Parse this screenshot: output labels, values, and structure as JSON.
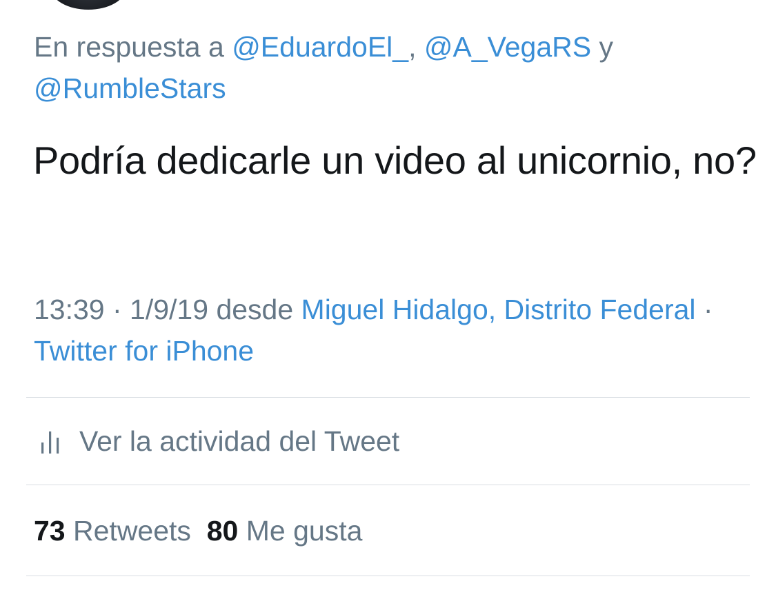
{
  "reply_context": {
    "prefix": "En respuesta a ",
    "mention_1": "@EduardoEl_",
    "separator": ", ",
    "mention_2": "@A_VegaRS",
    "conjunction": " y ",
    "mention_3": "@RumbleStars"
  },
  "tweet": {
    "text": "Podría dedicarle un video al unicornio, no?"
  },
  "meta": {
    "time": "13:39",
    "dot_1": " · ",
    "date": "1/9/19",
    "from_label": " desde ",
    "location": "Miguel Hidalgo, Distrito Federal",
    "dot_2": " · ",
    "client": "Twitter for iPhone"
  },
  "activity": {
    "icon": "bar-chart-icon",
    "label": "Ver la actividad del Tweet"
  },
  "stats": {
    "retweets_count": "73",
    "retweets_label": "Retweets",
    "likes_count": "80",
    "likes_label": "Me gusta"
  },
  "colors": {
    "link": "#3a8ed6",
    "secondary": "#657786",
    "primary": "#14171a",
    "divider": "#d8dde2"
  }
}
